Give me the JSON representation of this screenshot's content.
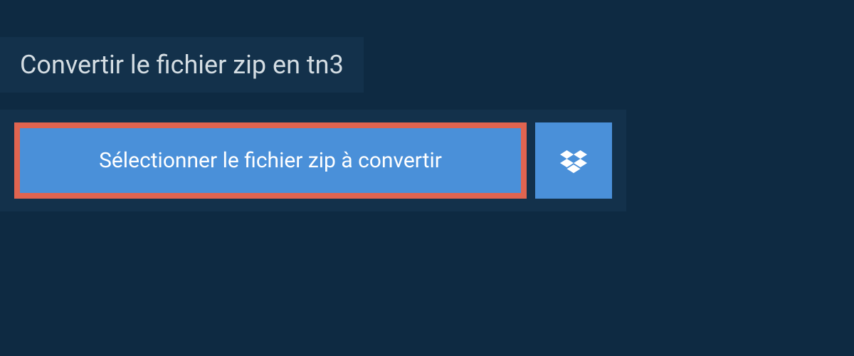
{
  "header": {
    "title": "Convertir le fichier zip en tn3"
  },
  "main": {
    "select_button_label": "Sélectionner le fichier zip à convertir"
  },
  "colors": {
    "background": "#0e2a42",
    "panel": "#13314b",
    "button": "#4a90d9",
    "highlight_border": "#e06450",
    "text_light": "#d4dde3",
    "text_white": "#ffffff"
  }
}
